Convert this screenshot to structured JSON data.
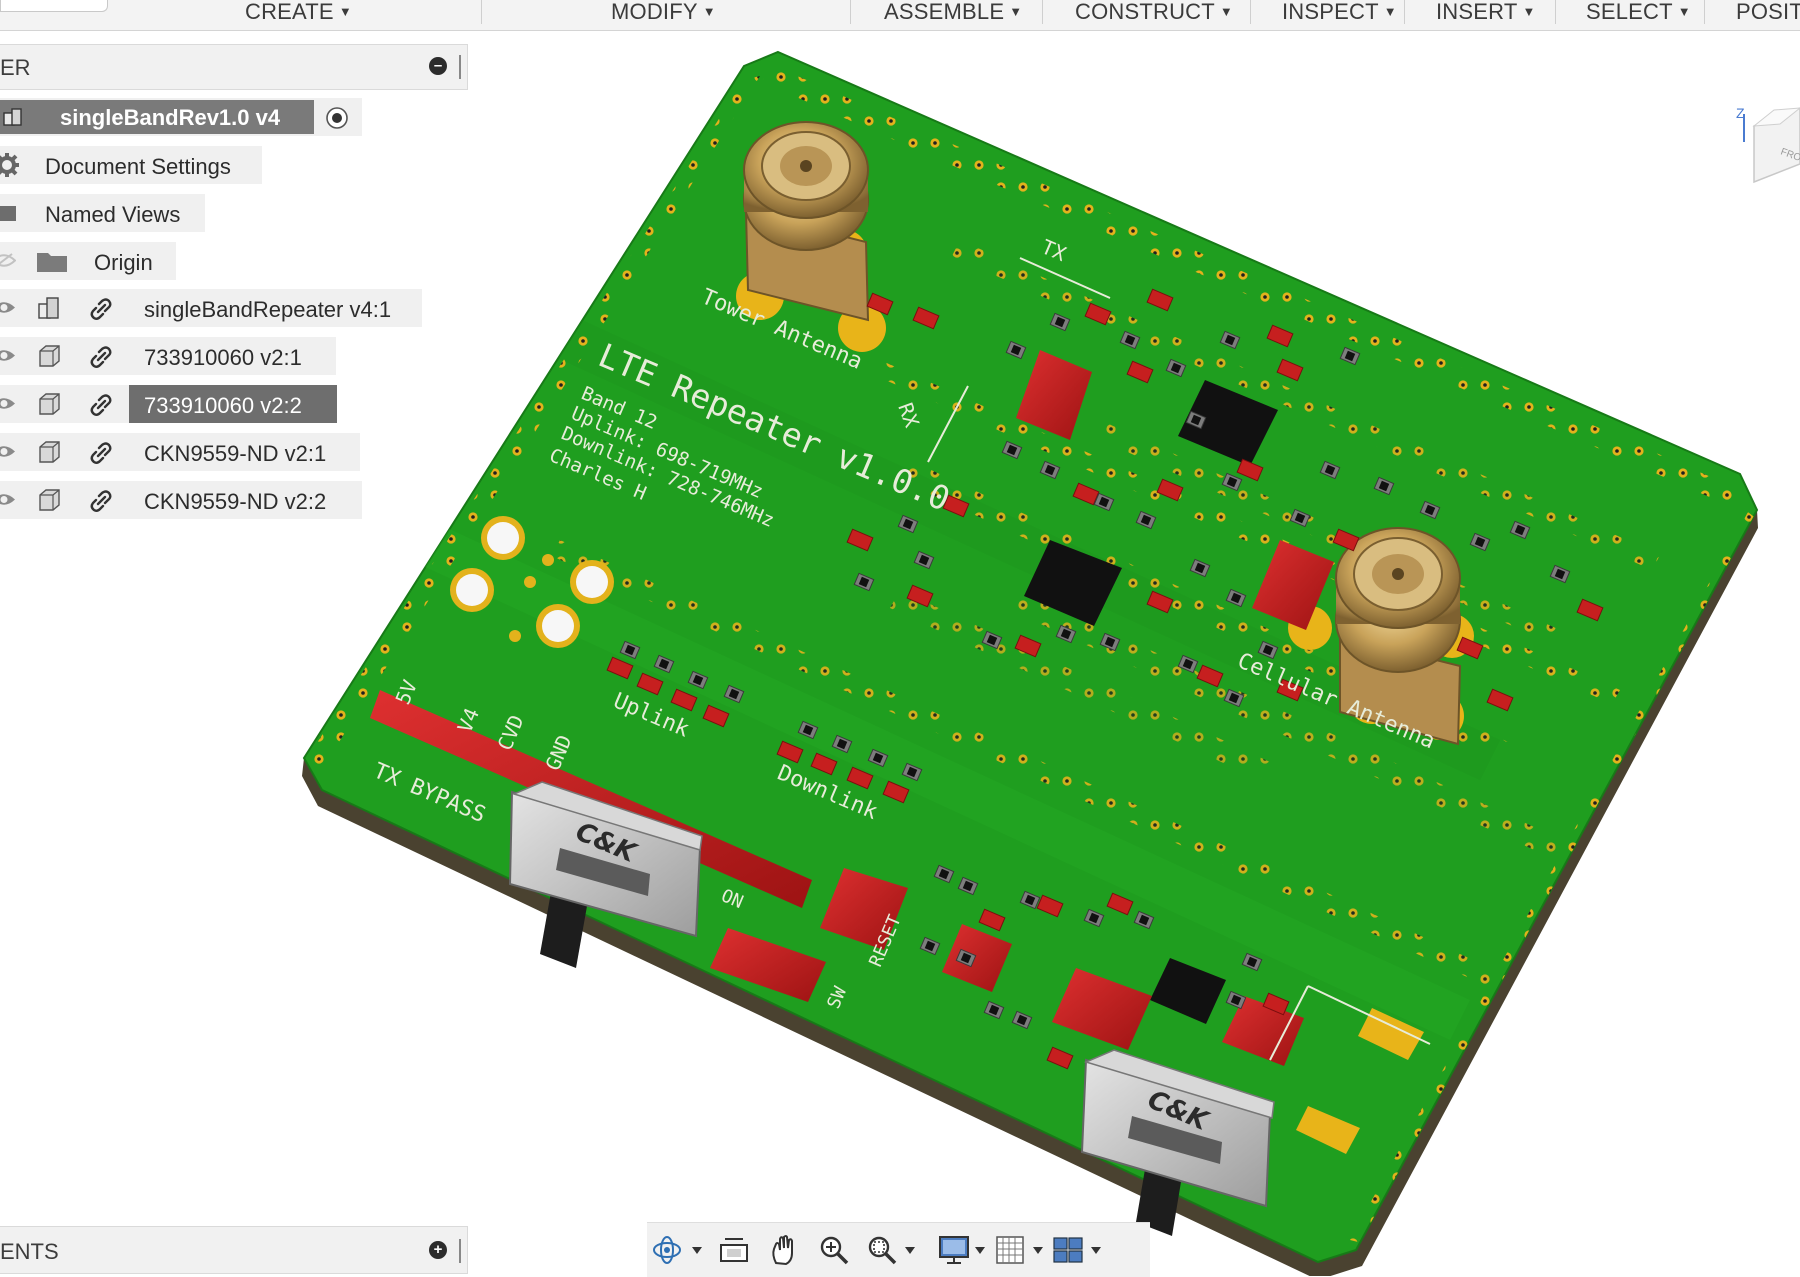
{
  "toolbar_menu": {
    "create": "CREATE",
    "modify": "MODIFY",
    "assemble": "ASSEMBLE",
    "construct": "CONSTRUCT",
    "inspect": "INSPECT",
    "insert": "INSERT",
    "select": "SELECT",
    "position": "POSIT"
  },
  "browser": {
    "title": "ER",
    "root_item": "singleBandRev1.0 v4",
    "items": [
      {
        "label": "Document Settings",
        "icon": "gear-icon"
      },
      {
        "label": "Named Views",
        "icon": "folder-icon"
      },
      {
        "label": "Origin",
        "icon": "folder-icon"
      },
      {
        "label": "singleBandRepeater v4:1",
        "icon": "component-icon"
      },
      {
        "label": "733910060 v2:1",
        "icon": "body-icon"
      },
      {
        "label": "733910060 v2:2",
        "icon": "body-icon",
        "selected": true
      },
      {
        "label": "CKN9559-ND v2:1",
        "icon": "body-icon"
      },
      {
        "label": "CKN9559-ND v2:2",
        "icon": "body-icon"
      }
    ]
  },
  "comments_panel": {
    "title": "ENTS"
  },
  "pcb": {
    "title": "LTE Repeater v1.0.0",
    "band": "Band 12",
    "uplink": "Uplink: 698-719MHz",
    "downlink": "Downlink: 728-746MHz",
    "author": "Charles H",
    "tower_antenna": "Tower Antenna",
    "cellular_antenna": "Cellular Antenna",
    "uplink_label": "Uplink",
    "downlink_label": "Downlink",
    "tx_bypass": "TX BYPASS",
    "tx": "TX",
    "rx": "RX",
    "reset": "RESET",
    "on": "ON",
    "sw": "SW",
    "pins": [
      "5V",
      "V4",
      "CVD",
      "GND"
    ],
    "switch_brand": "C&K"
  },
  "view_cube": {
    "axis": "Z",
    "face": "FRO"
  },
  "colors": {
    "board": "#1f9e1f",
    "board_edge": "#4a4230",
    "silkscreen": "#e7ecd9",
    "pad": "#f2b51a",
    "component_red": "#c61f1f",
    "ic_black": "#111111",
    "selected_row": "#6e6e6e",
    "root_row": "#7a7a7a"
  }
}
